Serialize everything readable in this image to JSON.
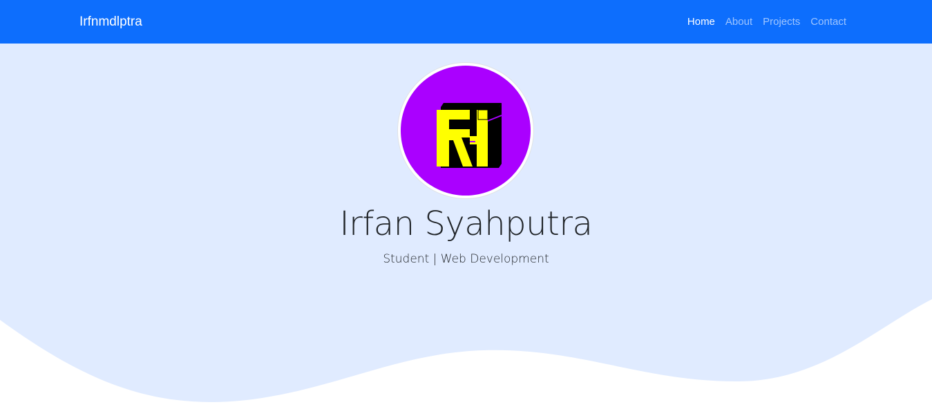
{
  "navbar": {
    "brand": "Irfnmdlptra",
    "links": [
      {
        "label": "Home",
        "active": true
      },
      {
        "label": "About",
        "active": false
      },
      {
        "label": "Projects",
        "active": false
      },
      {
        "label": "Contact",
        "active": false
      }
    ]
  },
  "hero": {
    "avatar_icon": "rf-monogram-logo",
    "name": "Irfan Syahputra",
    "tagline": "Student | Web Development"
  },
  "colors": {
    "navbar_bg": "#0d6efd",
    "hero_bg": "#e0ebff",
    "wave_fill": "#ffffff",
    "logo_circle": "#aa00ff",
    "logo_letters": "#ffff00",
    "logo_shadow": "#000000",
    "text_dark": "#212529"
  }
}
